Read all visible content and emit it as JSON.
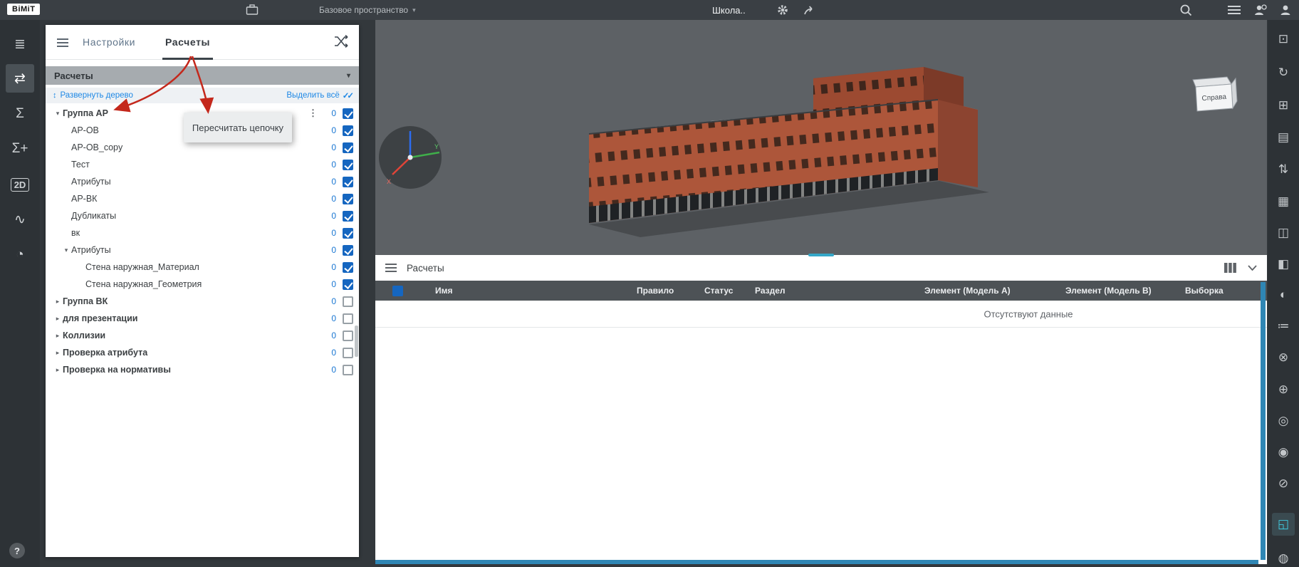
{
  "topbar": {
    "logo": "BiMiT",
    "workspace": "Базовое пространство",
    "title": "Школа.."
  },
  "tabs": {
    "settings": "Настройки",
    "calculations": "Расчеты"
  },
  "panel": {
    "section_title": "Расчеты",
    "expand_tree": "Развернуть дерево",
    "select_all": "Выделить всё",
    "context_menu": "Пересчитать цепочку",
    "tree": [
      {
        "label": "Группа АР",
        "count": "0",
        "arrow": "▾",
        "checked": true
      },
      {
        "label": "АР-ОВ",
        "count": "0",
        "arrow": "",
        "checked": true
      },
      {
        "label": "АР-ОВ_copy",
        "count": "0",
        "arrow": "",
        "checked": true
      },
      {
        "label": "Тест",
        "count": "0",
        "arrow": "",
        "checked": true
      },
      {
        "label": "Атрибуты",
        "count": "0",
        "arrow": "",
        "checked": true
      },
      {
        "label": "АР-ВК",
        "count": "0",
        "arrow": "",
        "checked": true
      },
      {
        "label": "Дубликаты",
        "count": "0",
        "arrow": "",
        "checked": true
      },
      {
        "label": "вк",
        "count": "0",
        "arrow": "",
        "checked": true
      },
      {
        "label": "Атрибуты",
        "count": "0",
        "arrow": "▾",
        "checked": true
      },
      {
        "label": "Стена наружная_Материал",
        "count": "0",
        "arrow": "",
        "checked": true
      },
      {
        "label": "Стена наружная_Геометрия",
        "count": "0",
        "arrow": "",
        "checked": true
      },
      {
        "label": "Группа ВК",
        "count": "0",
        "arrow": "▸",
        "checked": false
      },
      {
        "label": "для презентации",
        "count": "0",
        "arrow": "▸",
        "checked": false
      },
      {
        "label": "Коллизии",
        "count": "0",
        "arrow": "▸",
        "checked": false
      },
      {
        "label": "Проверка атрибута",
        "count": "0",
        "arrow": "▸",
        "checked": false
      },
      {
        "label": "Проверка на нормативы",
        "count": "0",
        "arrow": "▸",
        "checked": false
      }
    ]
  },
  "viewport": {
    "nav_cube": "Справа",
    "axis_x": "X",
    "axis_y": "Y"
  },
  "bottom": {
    "title": "Расчеты",
    "no_data": "Отсутствуют данные",
    "columns": [
      "Имя",
      "Правило",
      "Статус",
      "Раздел",
      "Элемент (Модель A)",
      "Элемент (Модель B)",
      "Выборка"
    ]
  },
  "left_toolbar": {
    "items": [
      {
        "name": "model-tree-icon",
        "glyph": "≣"
      },
      {
        "name": "checks-icon",
        "glyph": "⇄"
      },
      {
        "name": "sum-icon",
        "glyph": "Σ"
      },
      {
        "name": "sum-plus-icon",
        "glyph": "Σ+"
      },
      {
        "name": "2d-icon",
        "glyph": "2D"
      },
      {
        "name": "chart-icon",
        "glyph": "∿"
      },
      {
        "name": "gauge-icon",
        "glyph": "◔"
      }
    ]
  },
  "right_toolbar": {
    "items": [
      {
        "name": "capture-icon",
        "glyph": "⊡"
      },
      {
        "name": "orbit-icon",
        "glyph": "↻"
      },
      {
        "name": "layers-icon",
        "glyph": "⊞"
      },
      {
        "name": "notebook-icon",
        "glyph": "▤"
      },
      {
        "name": "sort-icon",
        "glyph": "⇅"
      },
      {
        "name": "materials-icon",
        "glyph": "▦"
      },
      {
        "name": "views-icon",
        "glyph": "◫"
      },
      {
        "name": "split-icon",
        "glyph": "◧"
      },
      {
        "name": "contrast-icon",
        "glyph": "◐"
      },
      {
        "name": "list-icon",
        "glyph": "≔"
      },
      {
        "name": "section-cut-icon",
        "glyph": "⊗"
      },
      {
        "name": "compass-icon",
        "glyph": "⊕"
      },
      {
        "name": "target-icon",
        "glyph": "◎"
      },
      {
        "name": "visibility-icon",
        "glyph": "◉"
      },
      {
        "name": "hide-icon",
        "glyph": "⊘"
      },
      {
        "name": "model-cube-icon",
        "glyph": "◱"
      },
      {
        "name": "sphere-icon",
        "glyph": "◍"
      }
    ]
  },
  "icons": {
    "caret_down": "▾",
    "double_check": "✓✓",
    "expand_updown": "↕",
    "kebab": "⋮"
  },
  "help": {
    "label": "?"
  }
}
